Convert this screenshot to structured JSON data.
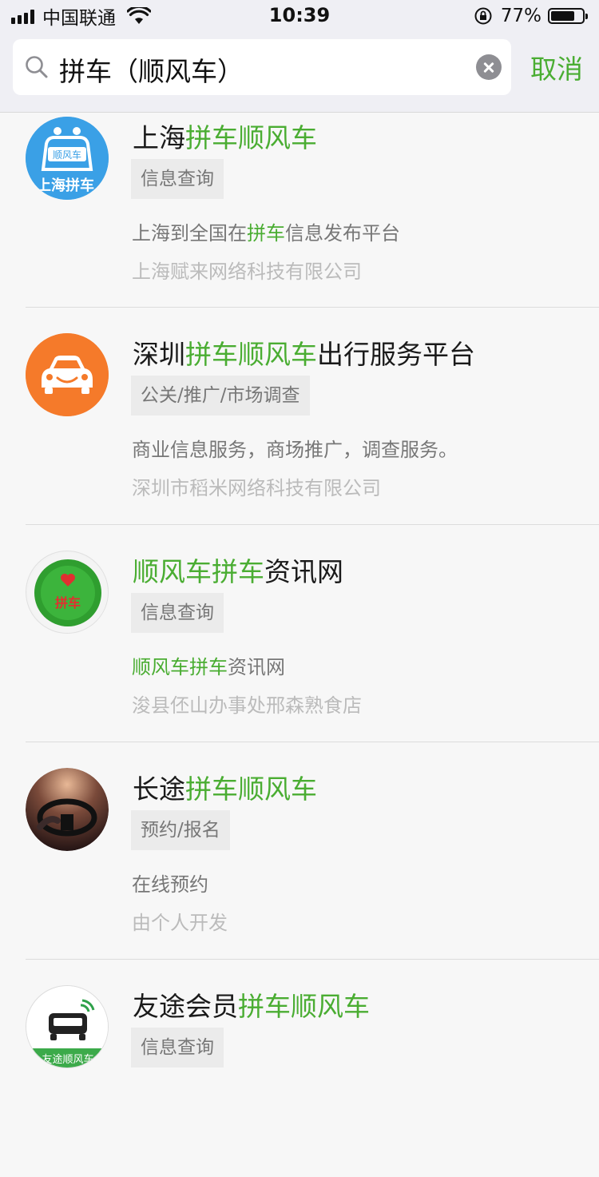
{
  "status_bar": {
    "carrier": "中国联通",
    "time": "10:39",
    "battery_percent_label": "77%",
    "battery_level": 0.77
  },
  "search": {
    "query": "拼车（顺风车）",
    "cancel_label": "取消"
  },
  "results": [
    {
      "title_pre": "上海",
      "title_hl": "拼车顺风车",
      "title_post": "",
      "tag": "信息查询",
      "desc_pre": "上海到全国在",
      "desc_hl": "拼车",
      "desc_post": "信息发布平台",
      "company": "上海赋来网络科技有限公司",
      "avatar_text_top": "顺风车",
      "avatar_text_bottom": "上海拼车"
    },
    {
      "title_pre": "深圳",
      "title_hl": "拼车顺风车",
      "title_post": "出行服务平台",
      "tag": "公关/推广/市场调查",
      "desc_pre": "商业信息服务，商场推广，调查服务。",
      "desc_hl": "",
      "desc_post": "",
      "company": "深圳市稻米网络科技有限公司"
    },
    {
      "title_pre": "",
      "title_hl": "顺风车拼车",
      "title_post": "资讯网",
      "tag": "信息查询",
      "desc_pre": "",
      "desc_hl": "顺风车拼车",
      "desc_post": "资讯网",
      "company": "浚县伾山办事处邢森熟食店",
      "avatar_text": "拼车"
    },
    {
      "title_pre": "长途",
      "title_hl": "拼车顺风车",
      "title_post": "",
      "tag": "预约/报名",
      "desc_pre": "在线预约",
      "desc_hl": "",
      "desc_post": "",
      "company": "由个人开发"
    },
    {
      "title_pre": "友途会员",
      "title_hl": "拼车顺风车",
      "title_post": "",
      "tag": "信息查询",
      "avatar_text": "友途顺风车"
    }
  ],
  "colors": {
    "accent_green": "#4aad32",
    "blue_avatar": "#3aa0e6",
    "orange_avatar": "#f57a2a"
  },
  "icons": {
    "search": "search-icon",
    "clear": "clear-icon",
    "wifi": "wifi-icon",
    "orientation_lock": "orientation-lock-icon",
    "battery": "battery-icon"
  }
}
